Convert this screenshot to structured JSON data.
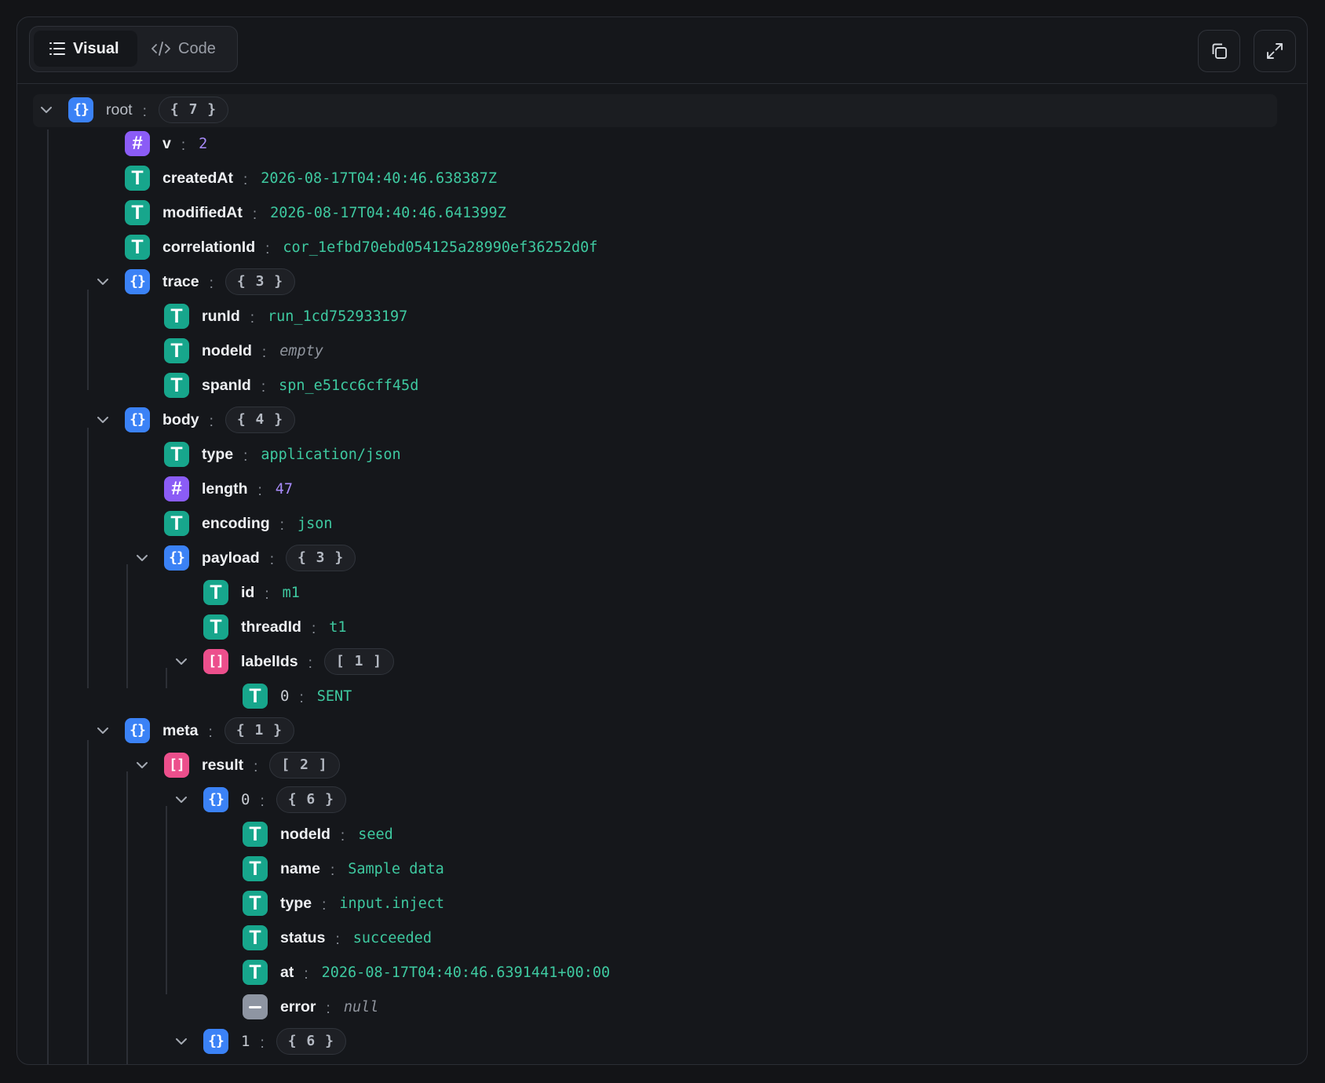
{
  "tabs": {
    "visual_label": "Visual",
    "code_label": "Code"
  },
  "actions": {
    "copy_icon": "copy-icon",
    "expand_icon": "expand-icon"
  },
  "colors": {
    "string_badge": "#17a68c",
    "number_badge": "#8b5cf6",
    "object_badge": "#3b82f6",
    "array_badge": "#ec4f8c",
    "null_badge": "#8e95a2",
    "string_value": "#3ec9a0",
    "number_value": "#a88bfa"
  },
  "tree": {
    "root": {
      "key": "root",
      "count": "{ 7 }"
    },
    "v": {
      "key": "v",
      "value": "2"
    },
    "createdAt": {
      "key": "createdAt",
      "value": "2026-08-17T04:40:46.638387Z"
    },
    "modifiedAt": {
      "key": "modifiedAt",
      "value": "2026-08-17T04:40:46.641399Z"
    },
    "correlationId": {
      "key": "correlationId",
      "value": "cor_1efbd70ebd054125a28990ef36252d0f"
    },
    "trace": {
      "key": "trace",
      "count": "{ 3 }",
      "runId": {
        "key": "runId",
        "value": "run_1cd752933197"
      },
      "nodeId": {
        "key": "nodeId",
        "value": "empty"
      },
      "spanId": {
        "key": "spanId",
        "value": "spn_e51cc6cff45d"
      }
    },
    "body": {
      "key": "body",
      "count": "{ 4 }",
      "type": {
        "key": "type",
        "value": "application/json"
      },
      "length": {
        "key": "length",
        "value": "47"
      },
      "encoding": {
        "key": "encoding",
        "value": "json"
      },
      "payload": {
        "key": "payload",
        "count": "{ 3 }",
        "id": {
          "key": "id",
          "value": "m1"
        },
        "threadId": {
          "key": "threadId",
          "value": "t1"
        },
        "labelIds": {
          "key": "labelIds",
          "count": "[ 1 ]",
          "item0": {
            "key": "0",
            "value": "SENT"
          }
        }
      }
    },
    "meta": {
      "key": "meta",
      "count": "{ 1 }",
      "result": {
        "key": "result",
        "count": "[ 2 ]",
        "item0": {
          "key": "0",
          "count": "{ 6 }",
          "nodeId": {
            "key": "nodeId",
            "value": "seed"
          },
          "name": {
            "key": "name",
            "value": "Sample data"
          },
          "type": {
            "key": "type",
            "value": "input.inject"
          },
          "status": {
            "key": "status",
            "value": "succeeded"
          },
          "at": {
            "key": "at",
            "value": "2026-08-17T04:40:46.6391441+00:00"
          },
          "error": {
            "key": "error",
            "value": "null"
          }
        },
        "item1": {
          "key": "1",
          "count": "{ 6 }"
        }
      }
    }
  }
}
